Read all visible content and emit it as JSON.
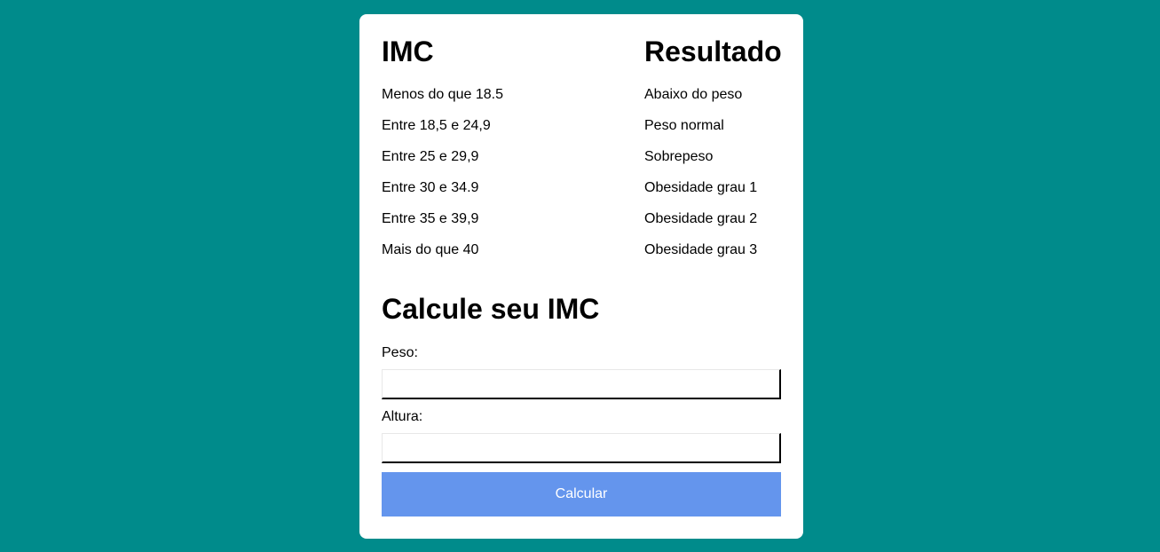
{
  "table": {
    "header_imc": "IMC",
    "header_result": "Resultado",
    "rows": [
      {
        "imc": "Menos do que 18.5",
        "result": "Abaixo do peso"
      },
      {
        "imc": "Entre 18,5 e 24,9",
        "result": "Peso normal"
      },
      {
        "imc": "Entre 25 e 29,9",
        "result": "Sobrepeso"
      },
      {
        "imc": "Entre 30 e 34.9",
        "result": "Obesidade grau 1"
      },
      {
        "imc": "Entre 35 e 39,9",
        "result": "Obesidade grau 2"
      },
      {
        "imc": "Mais do que 40",
        "result": "Obesidade grau 3"
      }
    ]
  },
  "form": {
    "title": "Calcule seu IMC",
    "weight_label": "Peso:",
    "weight_value": "",
    "height_label": "Altura:",
    "height_value": "",
    "submit_label": "Calcular"
  },
  "colors": {
    "background": "#008b8b",
    "card": "#ffffff",
    "button": "#6495ed",
    "button_text": "#ffffff"
  }
}
